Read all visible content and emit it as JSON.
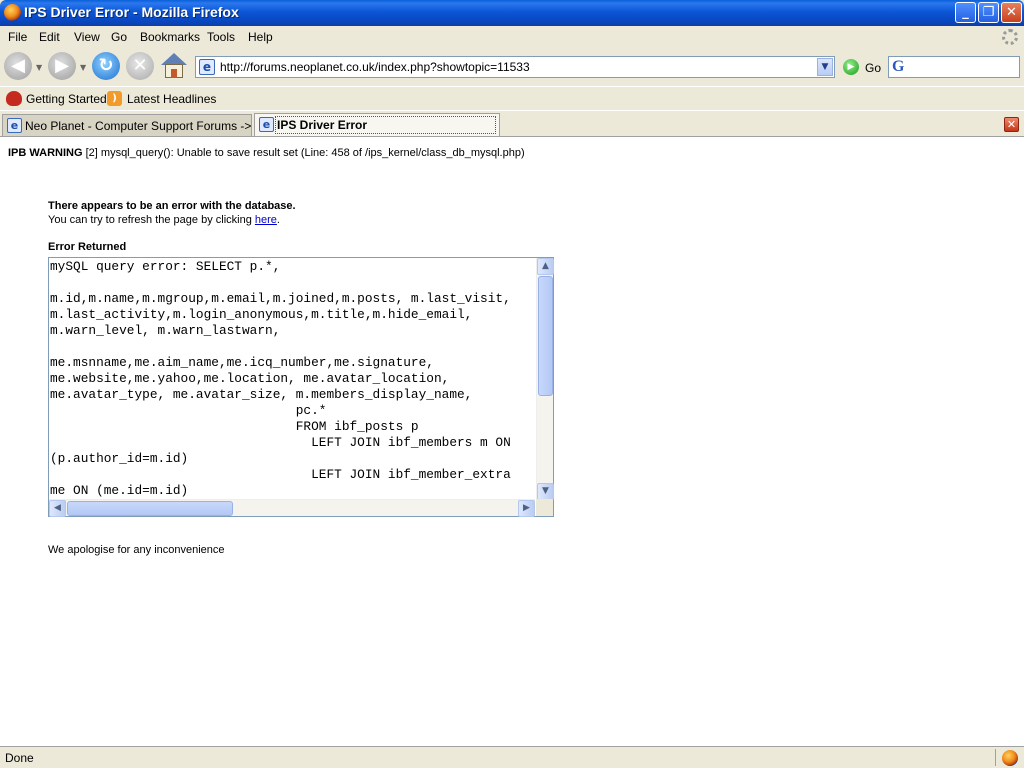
{
  "window": {
    "title": "IPS Driver Error - Mozilla Firefox",
    "minimize": "_",
    "maximize": "❐",
    "close": "✕"
  },
  "menu": {
    "items": [
      "File",
      "Edit",
      "View",
      "Go",
      "Bookmarks",
      "Tools",
      "Help"
    ]
  },
  "navigation": {
    "url": "http://forums.neoplanet.co.uk/index.php?showtopic=11533",
    "go_label": "Go",
    "search_placeholder": ""
  },
  "bookmarks": {
    "items": [
      "Getting Started",
      "Latest Headlines"
    ]
  },
  "tabs": [
    {
      "label": "Neo Planet - Computer Support Forums -> ...",
      "active": false
    },
    {
      "label": "IPS Driver Error",
      "active": true
    }
  ],
  "page": {
    "warning_prefix": "IPB WARNING",
    "warning_text": " [2] mysql_query(): Unable to save result set (Line: 458 of /ips_kernel/class_db_mysql.php)",
    "error_heading": "There appears to be an error with the database.",
    "refresh_text": "You can try to refresh the page by clicking ",
    "refresh_link": "here",
    "refresh_end": ".",
    "error_returned_label": "Error Returned",
    "error_lines": [
      "mySQL query error: SELECT p.*,",
      "",
      "m.id,m.name,m.mgroup,m.email,m.joined,m.posts, m.last_visit,",
      "m.last_activity,m.login_anonymous,m.title,m.hide_email,",
      "m.warn_level, m.warn_lastwarn,",
      "",
      "me.msnname,me.aim_name,me.icq_number,me.signature,",
      "me.website,me.yahoo,me.location, me.avatar_location,",
      "me.avatar_type, me.avatar_size, m.members_display_name,",
      "                                pc.*",
      "                                FROM ibf_posts p",
      "                                  LEFT JOIN ibf_members m ON",
      "(p.author_id=m.id)",
      "                                  LEFT JOIN ibf_member_extra",
      "me ON (me.id=m.id)"
    ],
    "apology": "We apologise for any inconvenience"
  },
  "status": {
    "text": "Done"
  }
}
